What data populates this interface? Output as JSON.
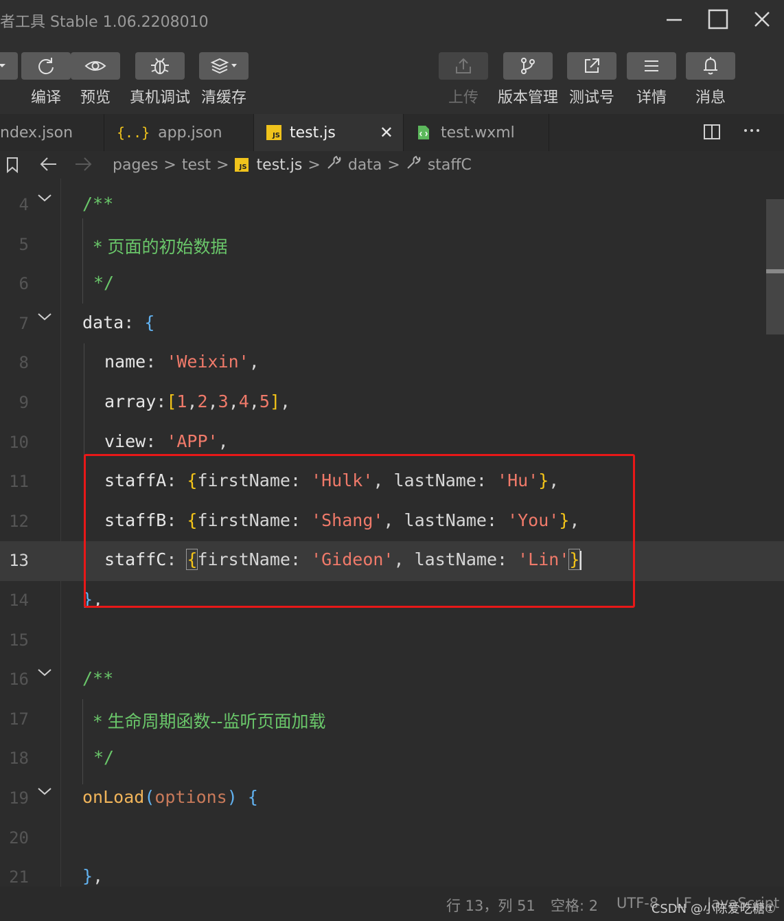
{
  "window": {
    "title": "者工具 Stable 1.06.2208010"
  },
  "toolbar": {
    "items": [
      {
        "label": "编译",
        "icon": "refresh-icon"
      },
      {
        "label": "预览",
        "icon": "eye-icon"
      },
      {
        "label": "真机调试",
        "icon": "bug-icon"
      },
      {
        "label": "清缓存",
        "icon": "layers-icon"
      },
      {
        "label": "上传",
        "icon": "upload-icon",
        "disabled": true
      },
      {
        "label": "版本管理",
        "icon": "branch-icon"
      },
      {
        "label": "测试号",
        "icon": "external-link-icon"
      },
      {
        "label": "详情",
        "icon": "menu-icon"
      },
      {
        "label": "消息",
        "icon": "bell-icon"
      }
    ]
  },
  "tabs": [
    {
      "label": "ndex.json"
    },
    {
      "label": "app.json",
      "icon": "braces-icon"
    },
    {
      "label": "test.js",
      "icon": "js-icon",
      "active": true,
      "close": "✕"
    },
    {
      "label": "test.wxml",
      "icon": "wxml-file-icon"
    }
  ],
  "breadcrumb": {
    "items": [
      "pages",
      "test",
      "test.js",
      "data",
      "staffC"
    ]
  },
  "editor": {
    "js_badge": "JS",
    "braces": "{..}",
    "line_numbers": [
      "4",
      "5",
      "6",
      "7",
      "8",
      "9",
      "10",
      "11",
      "12",
      "13",
      "14",
      "15",
      "16",
      "17",
      "18",
      "19",
      "20",
      "21"
    ],
    "current_line": "13",
    "comment1": {
      "open": "/**",
      "body": "* 页面的初始数据",
      "close": "*/"
    },
    "data_key": "data",
    "name": {
      "key": "name",
      "value": "'Weixin'"
    },
    "array": {
      "key": "array",
      "values": [
        "1",
        "2",
        "3",
        "4",
        "5"
      ]
    },
    "view": {
      "key": "view",
      "value": "'APP'"
    },
    "staffA": {
      "key": "staffA",
      "firstName": "'Hulk'",
      "lastName": "'Hu'"
    },
    "staffB": {
      "key": "staffB",
      "firstName": "'Shang'",
      "lastName": "'You'"
    },
    "staffC": {
      "key": "staffC",
      "firstName": "'Gideon'",
      "lastName": "'Lin'"
    },
    "first_name_key": "firstName",
    "last_name_key": "lastName",
    "comment2": {
      "open": "/**",
      "body": "* 生命周期函数--监听页面加载",
      "close": "*/"
    },
    "onload": {
      "name": "onLoad",
      "param": "options"
    }
  },
  "statusbar": {
    "position": "行 13，列 51",
    "spaces": "空格: 2",
    "encoding": "UTF-8",
    "eol": "LF",
    "language": "JavaScript",
    "watermark": "CSDN @小陈爱吃糖①"
  },
  "colors": {
    "highlight_box": "#e81818",
    "comment": "#6ac76a",
    "string": "#f07a6a",
    "bracket": "#f5c518"
  }
}
